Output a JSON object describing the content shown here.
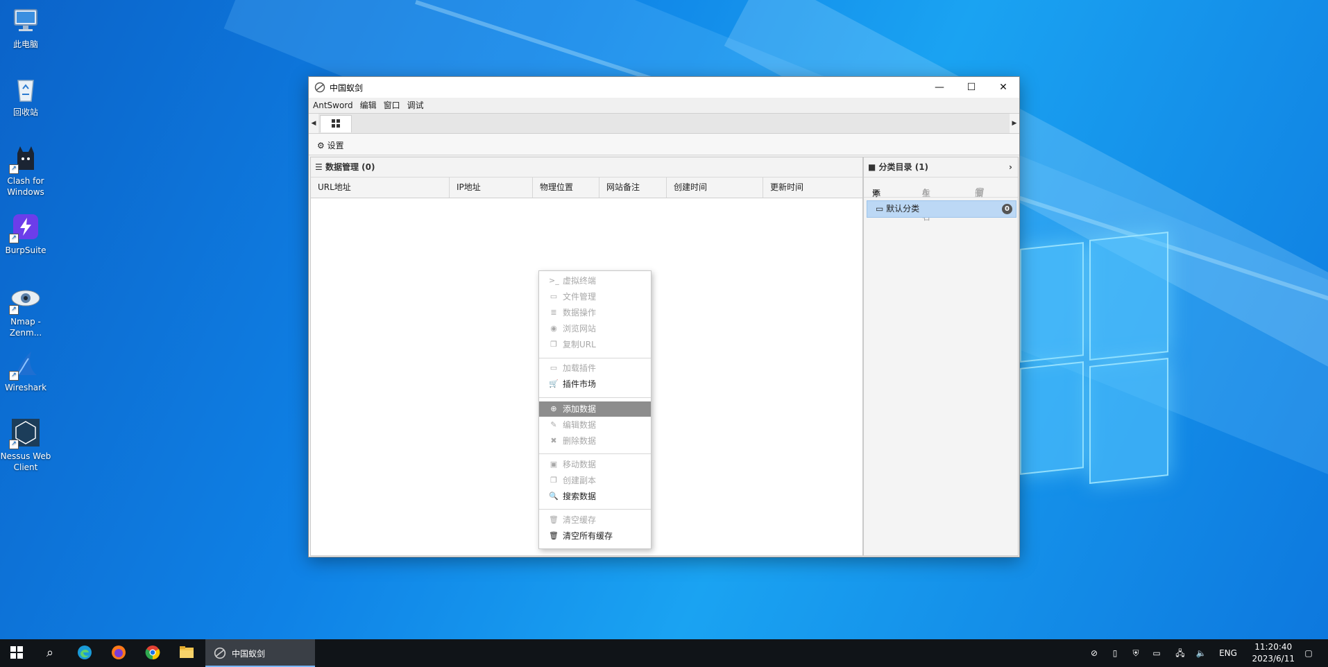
{
  "desktop": {
    "icons": [
      {
        "label": "此电脑",
        "icon": "computer-icon"
      },
      {
        "label": "回收站",
        "icon": "recycle-bin-icon"
      },
      {
        "label": "Clash for Windows",
        "icon": "clash-icon"
      },
      {
        "label": "BurpSuite",
        "icon": "burpsuite-icon"
      },
      {
        "label": "Nmap - Zenm...",
        "icon": "nmap-icon"
      },
      {
        "label": "Wireshark",
        "icon": "wireshark-icon"
      },
      {
        "label": "Nessus Web Client",
        "icon": "nessus-icon"
      }
    ]
  },
  "window": {
    "title": "中国蚁剑",
    "controls": {
      "minimize": "—",
      "maximize": "☐",
      "close": "✕"
    },
    "menu": [
      "AntSword",
      "编辑",
      "窗口",
      "调试"
    ],
    "toolbar": {
      "settings": "设置"
    }
  },
  "data_panel": {
    "title": "数据管理 (0)",
    "columns": [
      "URL地址",
      "IP地址",
      "物理位置",
      "网站备注",
      "创建时间",
      "更新时间"
    ]
  },
  "category_panel": {
    "title": "分类目录 (1)",
    "actions": {
      "add": "添加",
      "rename": "重命名",
      "delete": "删除"
    },
    "items": [
      {
        "label": "默认分类",
        "count": "0"
      }
    ]
  },
  "context_menu": {
    "items": [
      {
        "label": "虚拟终端",
        "icon": "terminal-icon",
        "enabled": false
      },
      {
        "label": "文件管理",
        "icon": "folder-icon",
        "enabled": false
      },
      {
        "label": "数据操作",
        "icon": "database-icon",
        "enabled": false
      },
      {
        "label": "浏览网站",
        "icon": "browser-icon",
        "enabled": false
      },
      {
        "label": "复制URL",
        "icon": "copy-icon",
        "enabled": false
      },
      {
        "label": "加载插件",
        "icon": "folder-icon",
        "enabled": false
      },
      {
        "label": "插件市场",
        "icon": "cart-icon",
        "enabled": true
      },
      {
        "label": "添加数据",
        "icon": "plus-circle-icon",
        "enabled": true,
        "highlighted": true
      },
      {
        "label": "编辑数据",
        "icon": "edit-icon",
        "enabled": false
      },
      {
        "label": "删除数据",
        "icon": "remove-icon",
        "enabled": false
      },
      {
        "label": "移动数据",
        "icon": "move-icon",
        "enabled": false
      },
      {
        "label": "创建副本",
        "icon": "copy-icon",
        "enabled": false
      },
      {
        "label": "搜索数据",
        "icon": "search-icon",
        "enabled": true
      },
      {
        "label": "清空缓存",
        "icon": "trash-icon",
        "enabled": false
      },
      {
        "label": "清空所有缓存",
        "icon": "trash-icon",
        "enabled": true
      }
    ]
  },
  "taskbar": {
    "active_app": "中国蚁剑",
    "language": "ENG",
    "time": "11:20:40",
    "date": "2023/6/11"
  },
  "colors": {
    "menu_highlight": "#8d8d8d",
    "category_selected": "#bcd8f5",
    "taskbar": "#101418"
  }
}
